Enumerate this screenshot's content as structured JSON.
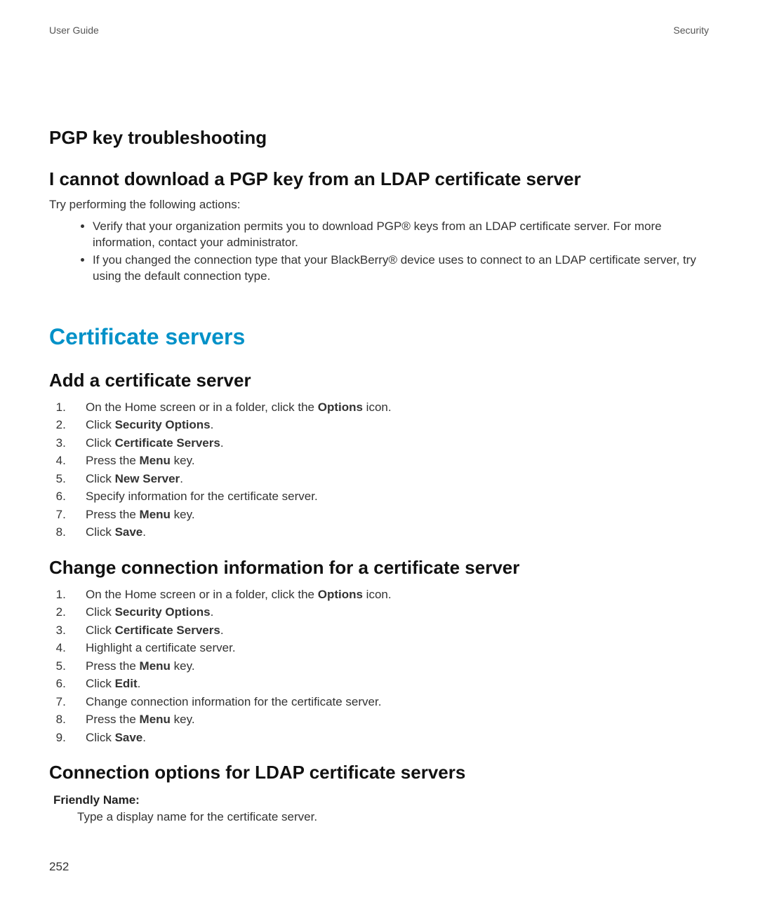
{
  "header": {
    "left": "User Guide",
    "right": "Security"
  },
  "h_trouble": "PGP key troubleshooting",
  "h_cannot": "I cannot download a PGP key from an LDAP certificate server",
  "intro": "Try performing the following actions:",
  "bullets": [
    "Verify that your organization permits you to download PGP® keys from an LDAP certificate server. For more information, contact your administrator.",
    "If you changed the connection type that your BlackBerry® device uses to connect to an LDAP certificate server, try using the default connection type."
  ],
  "h_certservers": "Certificate servers",
  "h_add": "Add a certificate server",
  "add_steps": [
    {
      "pre": "On the Home screen or in a folder, click the ",
      "bold": "Options",
      "post": " icon."
    },
    {
      "pre": "Click ",
      "bold": "Security Options",
      "post": "."
    },
    {
      "pre": "Click ",
      "bold": "Certificate Servers",
      "post": "."
    },
    {
      "pre": "Press the ",
      "bold": "Menu",
      "post": " key."
    },
    {
      "pre": "Click ",
      "bold": "New Server",
      "post": "."
    },
    {
      "pre": "Specify information for the certificate server.",
      "bold": "",
      "post": ""
    },
    {
      "pre": "Press the ",
      "bold": "Menu",
      "post": " key."
    },
    {
      "pre": "Click ",
      "bold": "Save",
      "post": "."
    }
  ],
  "h_change": "Change connection information for a certificate server",
  "change_steps": [
    {
      "pre": "On the Home screen or in a folder, click the ",
      "bold": "Options",
      "post": " icon."
    },
    {
      "pre": "Click ",
      "bold": "Security Options",
      "post": "."
    },
    {
      "pre": "Click ",
      "bold": "Certificate Servers",
      "post": "."
    },
    {
      "pre": "Highlight a certificate server.",
      "bold": "",
      "post": ""
    },
    {
      "pre": "Press the ",
      "bold": "Menu",
      "post": " key."
    },
    {
      "pre": "Click ",
      "bold": "Edit",
      "post": "."
    },
    {
      "pre": "Change connection information for the certificate server.",
      "bold": "",
      "post": ""
    },
    {
      "pre": "Press the ",
      "bold": "Menu",
      "post": " key."
    },
    {
      "pre": "Click ",
      "bold": "Save",
      "post": "."
    }
  ],
  "h_opts": "Connection options for LDAP certificate servers",
  "dl": {
    "term": "Friendly Name:",
    "def": "Type a display name for the certificate server."
  },
  "page_number": "252"
}
